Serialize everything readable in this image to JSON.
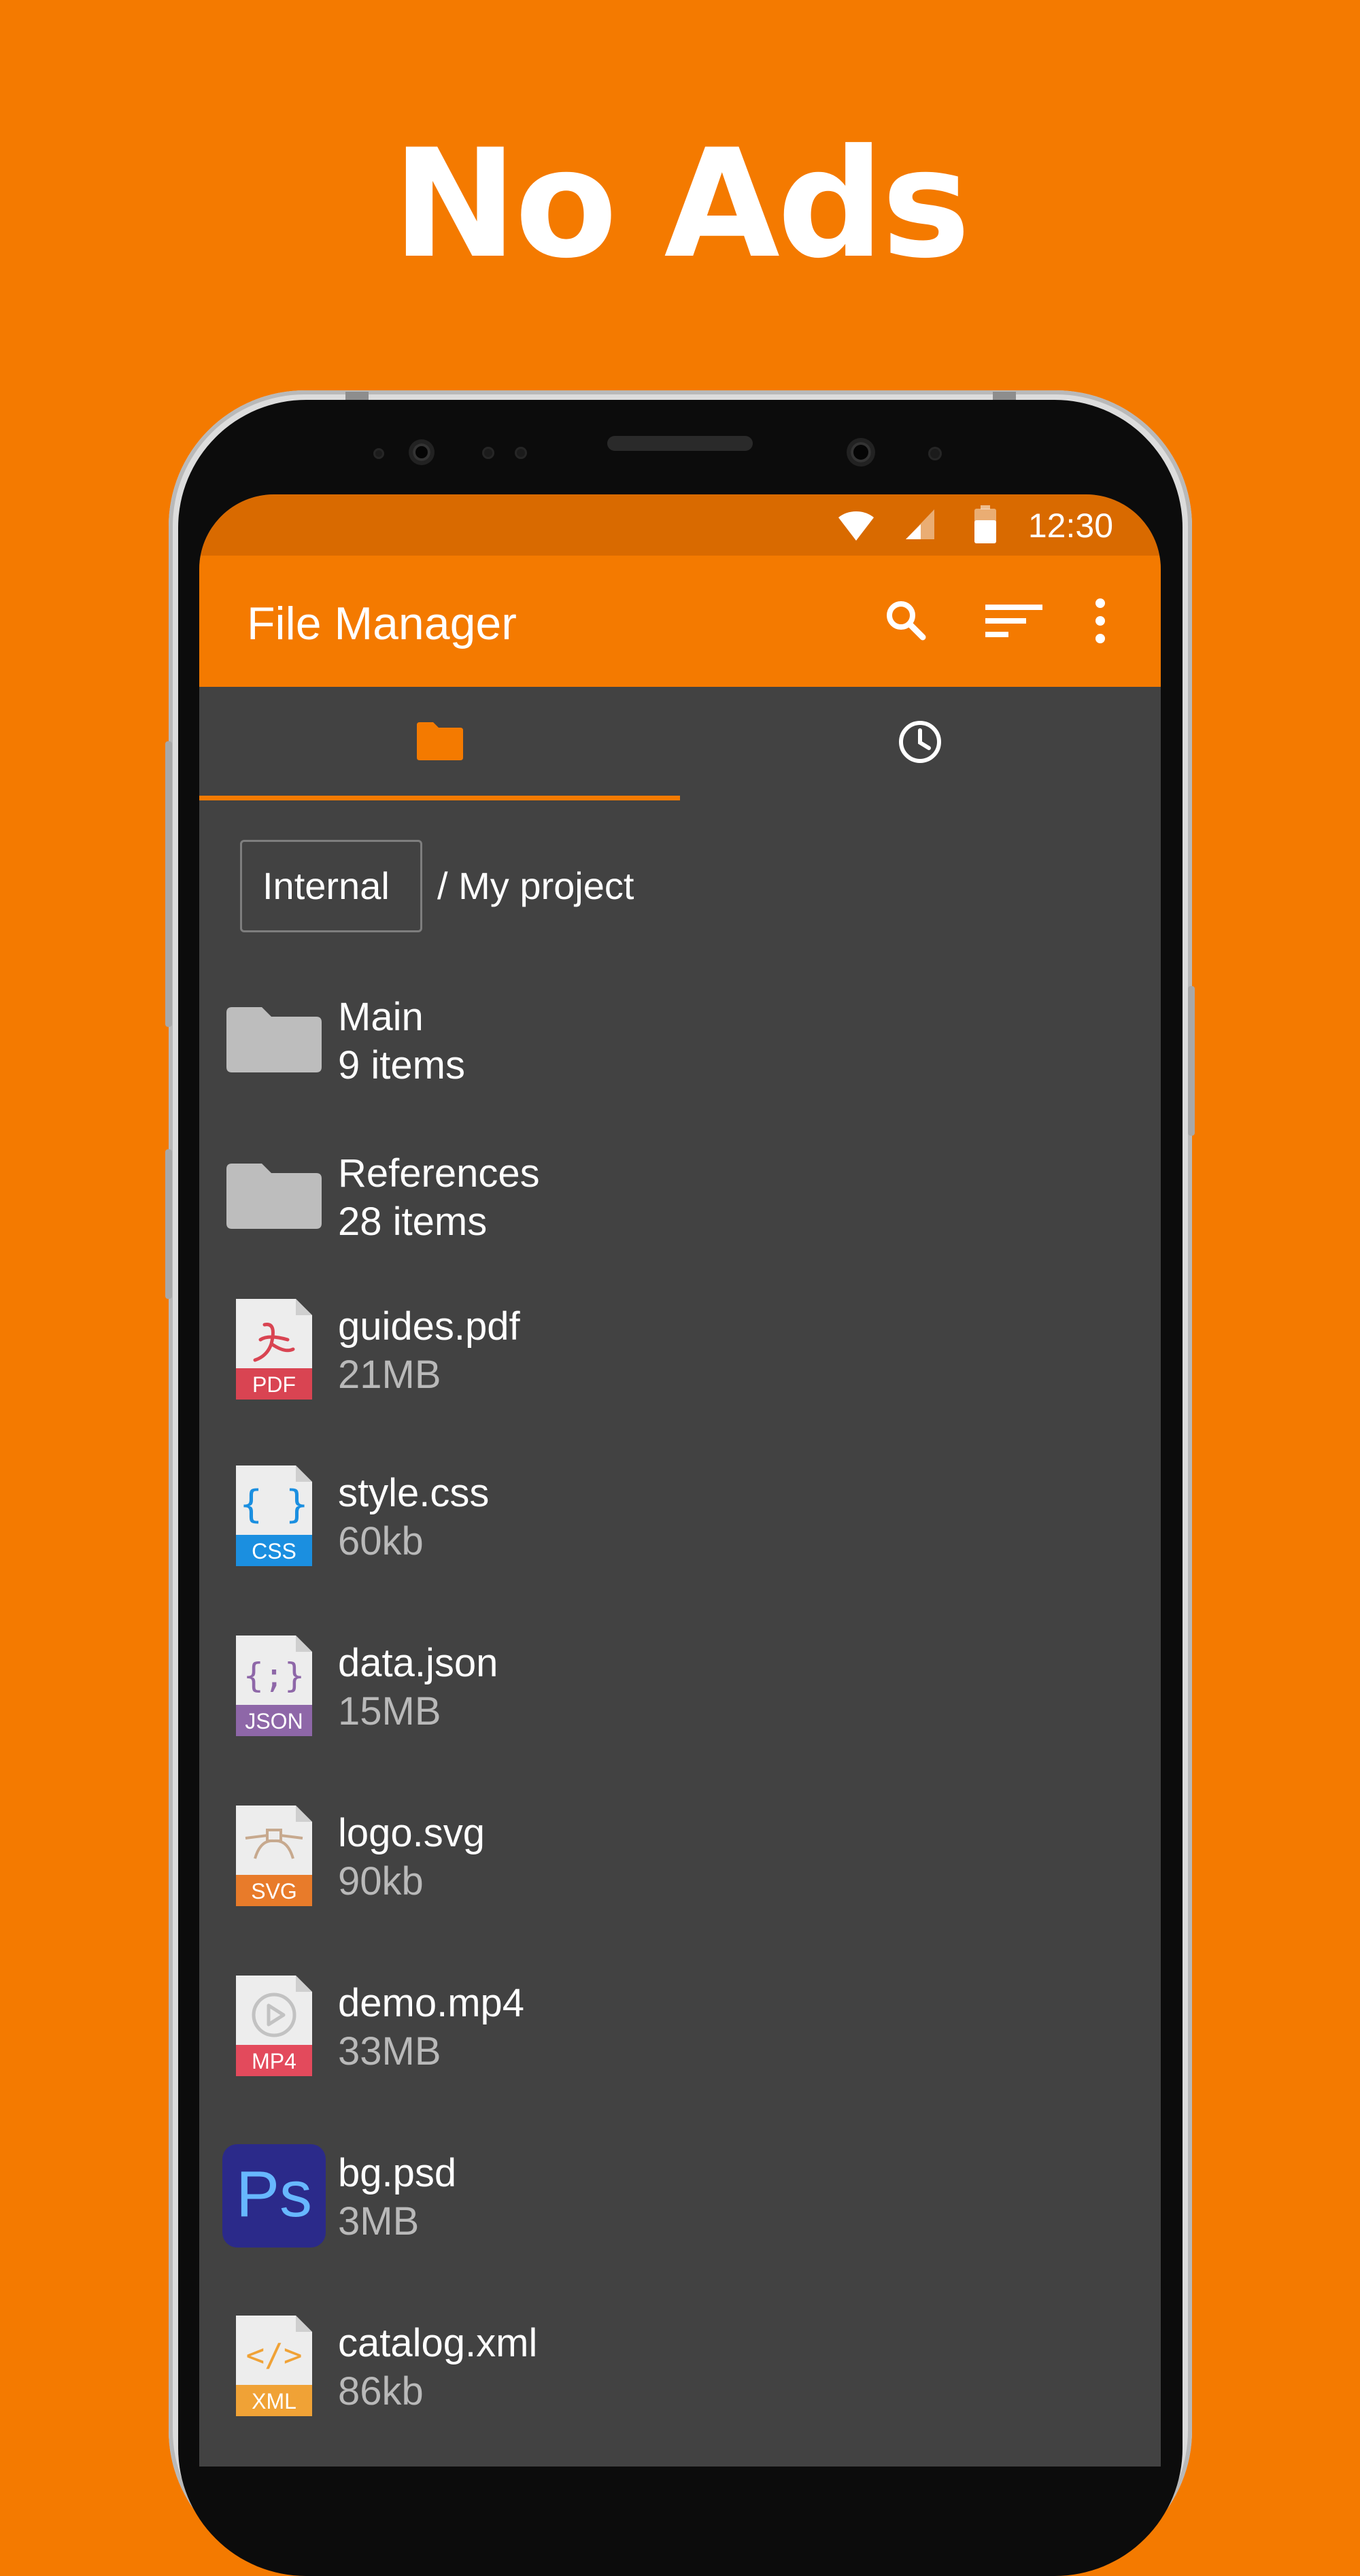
{
  "promo": {
    "headline": "No Ads"
  },
  "status_bar": {
    "time": "12:30"
  },
  "app_bar": {
    "title": "File Manager"
  },
  "breadcrumb": {
    "root": "Internal",
    "path": "/ My project"
  },
  "files": [
    {
      "name": "Main",
      "meta": "9 items",
      "icon": "folder-icon"
    },
    {
      "name": "References",
      "meta": "28 items",
      "icon": "folder-icon"
    },
    {
      "name": "guides.pdf",
      "meta": "21MB",
      "icon": "pdf-file-icon",
      "badge": "PDF",
      "badge_color": "#d94452"
    },
    {
      "name": "style.css",
      "meta": "60kb",
      "icon": "css-file-icon",
      "badge": "CSS",
      "badge_color": "#1b8fe0"
    },
    {
      "name": "data.json",
      "meta": "15MB",
      "icon": "json-file-icon",
      "badge": "JSON",
      "badge_color": "#8e67a8"
    },
    {
      "name": "logo.svg",
      "meta": "90kb",
      "icon": "svg-file-icon",
      "badge": "SVG",
      "badge_color": "#e87b2a"
    },
    {
      "name": "demo.mp4",
      "meta": "33MB",
      "icon": "mp4-file-icon",
      "badge": "MP4",
      "badge_color": "#e34a5c"
    },
    {
      "name": "bg.psd",
      "meta": "3MB",
      "icon": "photoshop-file-icon",
      "badge": "Ps",
      "badge_color": "#2b2a8a"
    },
    {
      "name": "catalog.xml",
      "meta": "86kb",
      "icon": "xml-file-icon",
      "badge": "XML",
      "badge_color": "#f0a236"
    }
  ],
  "colors": {
    "accent": "#f47a00",
    "status_bar": "#d96a00",
    "list_background": "#424242",
    "folder_meta_text": "#ffffff",
    "file_meta_text": "#b9b9b9"
  }
}
